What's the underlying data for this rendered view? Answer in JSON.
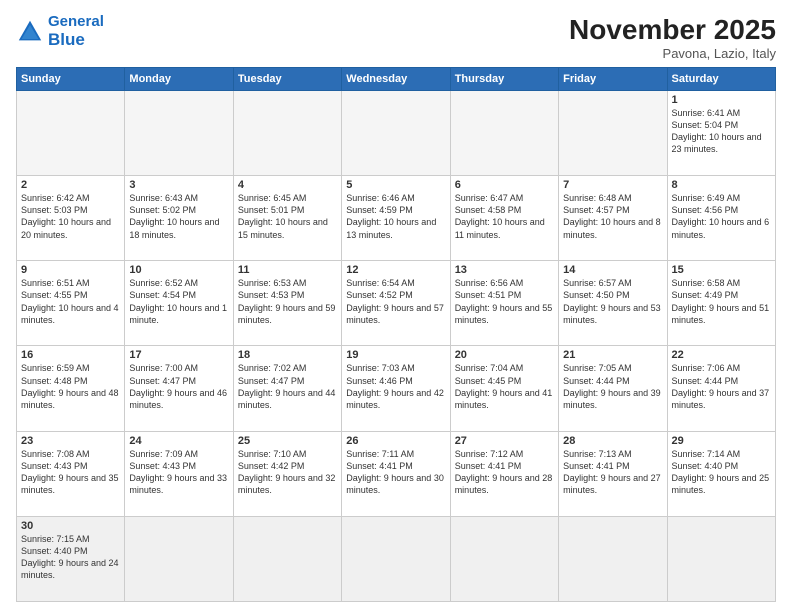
{
  "header": {
    "logo_general": "General",
    "logo_blue": "Blue",
    "month_title": "November 2025",
    "location": "Pavona, Lazio, Italy"
  },
  "weekdays": [
    "Sunday",
    "Monday",
    "Tuesday",
    "Wednesday",
    "Thursday",
    "Friday",
    "Saturday"
  ],
  "weeks": [
    [
      {
        "day": "",
        "empty": true
      },
      {
        "day": "",
        "empty": true
      },
      {
        "day": "",
        "empty": true
      },
      {
        "day": "",
        "empty": true
      },
      {
        "day": "",
        "empty": true
      },
      {
        "day": "",
        "empty": true
      },
      {
        "day": "1",
        "sunrise": "6:41 AM",
        "sunset": "5:04 PM",
        "daylight": "10 hours and 23 minutes."
      }
    ],
    [
      {
        "day": "2",
        "sunrise": "6:42 AM",
        "sunset": "5:03 PM",
        "daylight": "10 hours and 20 minutes."
      },
      {
        "day": "3",
        "sunrise": "6:43 AM",
        "sunset": "5:02 PM",
        "daylight": "10 hours and 18 minutes."
      },
      {
        "day": "4",
        "sunrise": "6:45 AM",
        "sunset": "5:01 PM",
        "daylight": "10 hours and 15 minutes."
      },
      {
        "day": "5",
        "sunrise": "6:46 AM",
        "sunset": "4:59 PM",
        "daylight": "10 hours and 13 minutes."
      },
      {
        "day": "6",
        "sunrise": "6:47 AM",
        "sunset": "4:58 PM",
        "daylight": "10 hours and 11 minutes."
      },
      {
        "day": "7",
        "sunrise": "6:48 AM",
        "sunset": "4:57 PM",
        "daylight": "10 hours and 8 minutes."
      },
      {
        "day": "8",
        "sunrise": "6:49 AM",
        "sunset": "4:56 PM",
        "daylight": "10 hours and 6 minutes."
      }
    ],
    [
      {
        "day": "9",
        "sunrise": "6:51 AM",
        "sunset": "4:55 PM",
        "daylight": "10 hours and 4 minutes."
      },
      {
        "day": "10",
        "sunrise": "6:52 AM",
        "sunset": "4:54 PM",
        "daylight": "10 hours and 1 minute."
      },
      {
        "day": "11",
        "sunrise": "6:53 AM",
        "sunset": "4:53 PM",
        "daylight": "9 hours and 59 minutes."
      },
      {
        "day": "12",
        "sunrise": "6:54 AM",
        "sunset": "4:52 PM",
        "daylight": "9 hours and 57 minutes."
      },
      {
        "day": "13",
        "sunrise": "6:56 AM",
        "sunset": "4:51 PM",
        "daylight": "9 hours and 55 minutes."
      },
      {
        "day": "14",
        "sunrise": "6:57 AM",
        "sunset": "4:50 PM",
        "daylight": "9 hours and 53 minutes."
      },
      {
        "day": "15",
        "sunrise": "6:58 AM",
        "sunset": "4:49 PM",
        "daylight": "9 hours and 51 minutes."
      }
    ],
    [
      {
        "day": "16",
        "sunrise": "6:59 AM",
        "sunset": "4:48 PM",
        "daylight": "9 hours and 48 minutes."
      },
      {
        "day": "17",
        "sunrise": "7:00 AM",
        "sunset": "4:47 PM",
        "daylight": "9 hours and 46 minutes."
      },
      {
        "day": "18",
        "sunrise": "7:02 AM",
        "sunset": "4:47 PM",
        "daylight": "9 hours and 44 minutes."
      },
      {
        "day": "19",
        "sunrise": "7:03 AM",
        "sunset": "4:46 PM",
        "daylight": "9 hours and 42 minutes."
      },
      {
        "day": "20",
        "sunrise": "7:04 AM",
        "sunset": "4:45 PM",
        "daylight": "9 hours and 41 minutes."
      },
      {
        "day": "21",
        "sunrise": "7:05 AM",
        "sunset": "4:44 PM",
        "daylight": "9 hours and 39 minutes."
      },
      {
        "day": "22",
        "sunrise": "7:06 AM",
        "sunset": "4:44 PM",
        "daylight": "9 hours and 37 minutes."
      }
    ],
    [
      {
        "day": "23",
        "sunrise": "7:08 AM",
        "sunset": "4:43 PM",
        "daylight": "9 hours and 35 minutes."
      },
      {
        "day": "24",
        "sunrise": "7:09 AM",
        "sunset": "4:43 PM",
        "daylight": "9 hours and 33 minutes."
      },
      {
        "day": "25",
        "sunrise": "7:10 AM",
        "sunset": "4:42 PM",
        "daylight": "9 hours and 32 minutes."
      },
      {
        "day": "26",
        "sunrise": "7:11 AM",
        "sunset": "4:41 PM",
        "daylight": "9 hours and 30 minutes."
      },
      {
        "day": "27",
        "sunrise": "7:12 AM",
        "sunset": "4:41 PM",
        "daylight": "9 hours and 28 minutes."
      },
      {
        "day": "28",
        "sunrise": "7:13 AM",
        "sunset": "4:41 PM",
        "daylight": "9 hours and 27 minutes."
      },
      {
        "day": "29",
        "sunrise": "7:14 AM",
        "sunset": "4:40 PM",
        "daylight": "9 hours and 25 minutes."
      }
    ],
    [
      {
        "day": "30",
        "sunrise": "7:15 AM",
        "sunset": "4:40 PM",
        "daylight": "9 hours and 24 minutes."
      },
      {
        "day": "",
        "empty": true
      },
      {
        "day": "",
        "empty": true
      },
      {
        "day": "",
        "empty": true
      },
      {
        "day": "",
        "empty": true
      },
      {
        "day": "",
        "empty": true
      },
      {
        "day": "",
        "empty": true
      }
    ]
  ]
}
